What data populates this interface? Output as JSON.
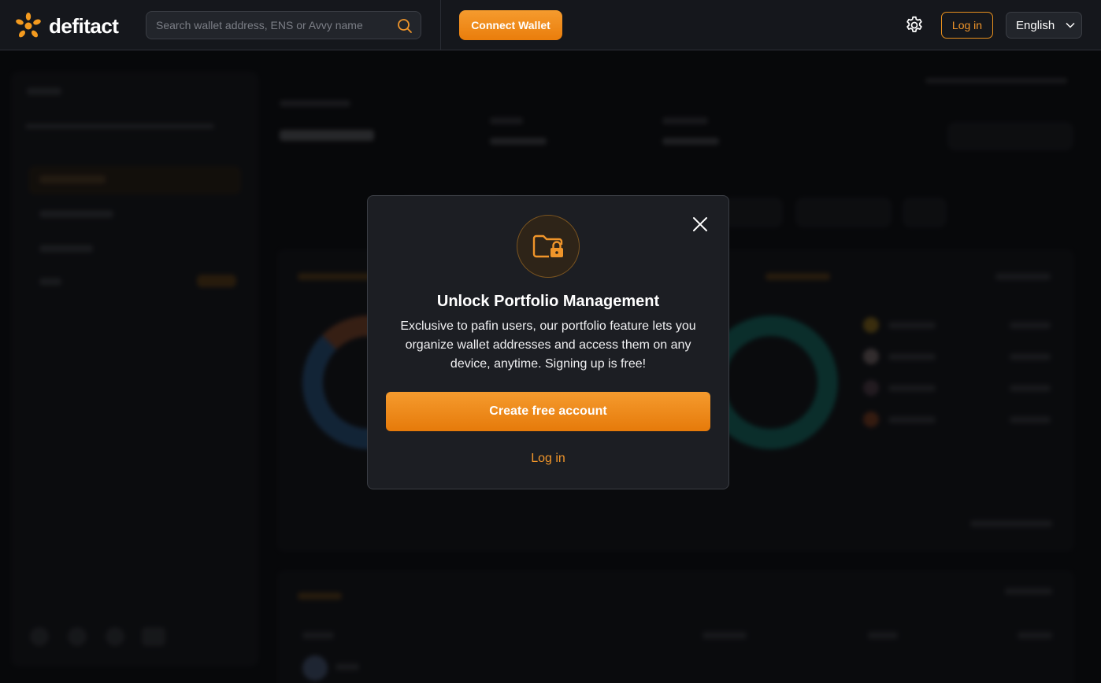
{
  "brand": {
    "name": "defitact",
    "accent": "#f08a14"
  },
  "header": {
    "search_placeholder": "Search wallet address, ENS or Avvy name",
    "connect_wallet": "Connect Wallet",
    "login": "Log in",
    "language": "English",
    "icons": {
      "search": "search-icon",
      "settings": "gear-icon",
      "language_chevron": "chevron-down-icon"
    }
  },
  "modal": {
    "icon": "folder-lock-icon",
    "title": "Unlock Portfolio Management",
    "description": "Exclusive to pafin users, our portfolio feature lets you organize wallet addresses and access them on any device, anytime. Signing up is free!",
    "create_account": "Create free account",
    "login": "Log in",
    "close_icon": "close-icon"
  }
}
